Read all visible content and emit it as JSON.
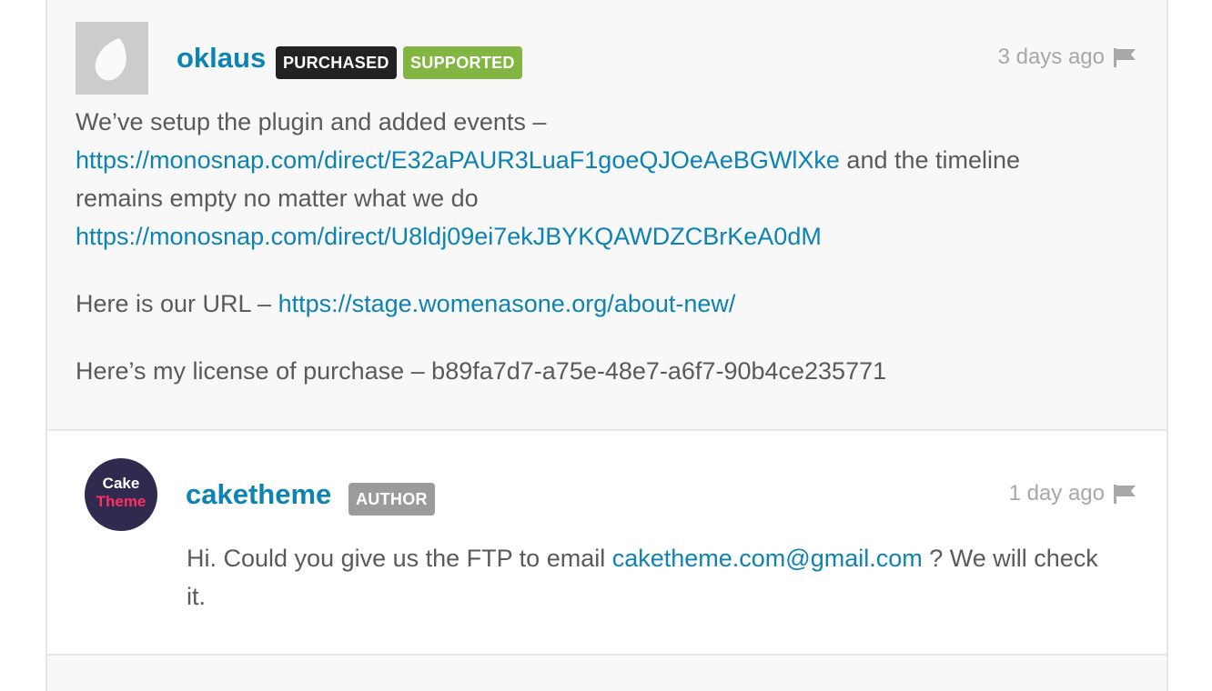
{
  "comments": [
    {
      "username": "oklaus",
      "badges": [
        "PURCHASED",
        "SUPPORTED"
      ],
      "date": "3 days ago",
      "p1_text1": "We’ve setup the plugin and added events –",
      "p1_link1": "https://monosnap.com/direct/E32aPAUR3LuaF1goeQJOeAeBGWlXke",
      "p1_text2": " and the timeline",
      "p1_text3": "remains empty no matter what we do",
      "p1_link2": "https://monosnap.com/direct/U8ldj09ei7ekJBYKQAWDZCBrKeA0dM",
      "p2_text": "Here is our URL – ",
      "p2_link": "https://stage.womenasone.org/about-new/",
      "p3_text": "Here’s my license of purchase – b89fa7d7-a75e-48e7-a6f7-90b4ce235771"
    },
    {
      "username": "caketheme",
      "avatar_line1": "Cake",
      "avatar_line2": "Theme",
      "badges": [
        "AUTHOR"
      ],
      "date": "1 day ago",
      "text1": "Hi. Could you give us the FTP to email ",
      "email": "caketheme.com@gmail.com",
      "text2": " ? We will check",
      "text3": "it."
    }
  ],
  "icons": {
    "flag": "flag-icon",
    "default_avatar": "envato-leaf-icon"
  },
  "colors": {
    "link": "#0d83b3",
    "purchased_badge": "#222222",
    "supported_badge": "#82b541",
    "author_badge": "#9b9b9b"
  }
}
